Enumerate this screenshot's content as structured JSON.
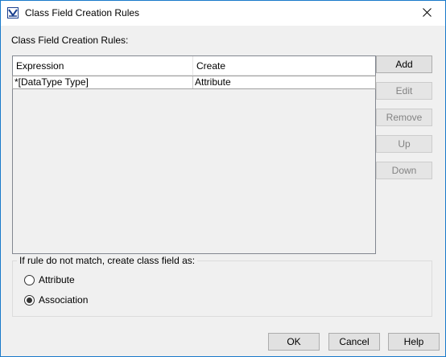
{
  "window": {
    "title": "Class Field Creation Rules",
    "title_color": "#1979ca"
  },
  "section_label": "Class Field Creation Rules:",
  "table": {
    "columns": [
      "Expression",
      "Create"
    ],
    "rows": [
      [
        "*[DataType Type]",
        "Attribute"
      ]
    ]
  },
  "side_buttons": {
    "add": "Add",
    "edit": "Edit",
    "remove": "Remove",
    "up": "Up",
    "down": "Down"
  },
  "fallback_group": {
    "legend": "If rule do not match, create class field as:",
    "options": [
      "Attribute",
      "Association"
    ],
    "selected": "Association"
  },
  "dialog_buttons": {
    "ok": "OK",
    "cancel": "Cancel",
    "help": "Help"
  },
  "icons": {
    "app": "magicdraw-app-icon",
    "close": "close-icon"
  }
}
